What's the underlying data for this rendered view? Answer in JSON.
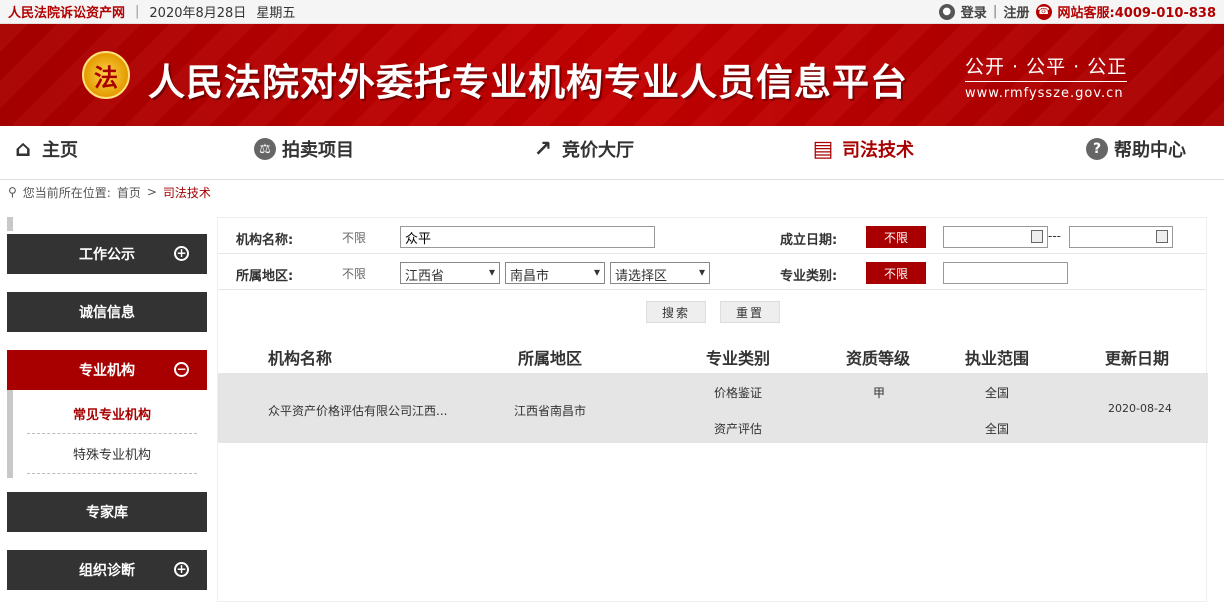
{
  "topbar": {
    "site": "人民法院诉讼资产网",
    "date": "2020年8月28日",
    "weekday": "星期五",
    "login": "登录",
    "register": "注册",
    "service": "网站客服:4009-010-838"
  },
  "banner": {
    "title": "人民法院对外委托专业机构专业人员信息平台",
    "slogan": "公开 · 公平 · 公正",
    "url": "www.rmfyssze.gov.cn",
    "emblem_text": "法"
  },
  "nav": {
    "items": [
      {
        "label": "主页",
        "icon": "home-icon"
      },
      {
        "label": "拍卖项目",
        "icon": "gavel-icon"
      },
      {
        "label": "竞价大厅",
        "icon": "chart-icon"
      },
      {
        "label": "司法技术",
        "icon": "book-icon"
      },
      {
        "label": "帮助中心",
        "icon": "help-icon"
      }
    ],
    "active": "司法技术"
  },
  "breadcrumb": {
    "prefix": "您当前所在位置:",
    "home": "首页",
    "sep": ">",
    "current": "司法技术"
  },
  "sidebar": {
    "items": [
      {
        "label": "工作公示",
        "toggle": "+"
      },
      {
        "label": "诚信信息",
        "toggle": ""
      },
      {
        "label": "专业机构",
        "toggle": "−"
      },
      {
        "label": "专家库",
        "toggle": ""
      },
      {
        "label": "组织诊断",
        "toggle": "+"
      }
    ],
    "sub": [
      "常见专业机构",
      "特殊专业机构"
    ]
  },
  "filters": {
    "org_name_label": "机构名称:",
    "org_unlimited": "不限",
    "org_value": "众平",
    "date_label": "成立日期:",
    "date_unlimited": "不限",
    "date_sep": "---",
    "region_label": "所属地区:",
    "region_unlimited": "不限",
    "province": "江西省",
    "city": "南昌市",
    "district": "请选择区",
    "category_label": "专业类别:",
    "category_unlimited": "不限",
    "search": "搜索",
    "reset": "重置"
  },
  "table": {
    "headers": [
      "机构名称",
      "所属地区",
      "专业类别",
      "资质等级",
      "执业范围",
      "更新日期"
    ],
    "rows": [
      {
        "name": "众平资产价格评估有限公司江西...",
        "region": "江西省南昌市",
        "categories": [
          "价格鉴证",
          "资产评估"
        ],
        "level": "甲",
        "scopes": [
          "全国",
          "全国"
        ],
        "date": "2020-08-24"
      }
    ]
  },
  "colors": {
    "accent": "#a80000",
    "dark": "#333333"
  }
}
